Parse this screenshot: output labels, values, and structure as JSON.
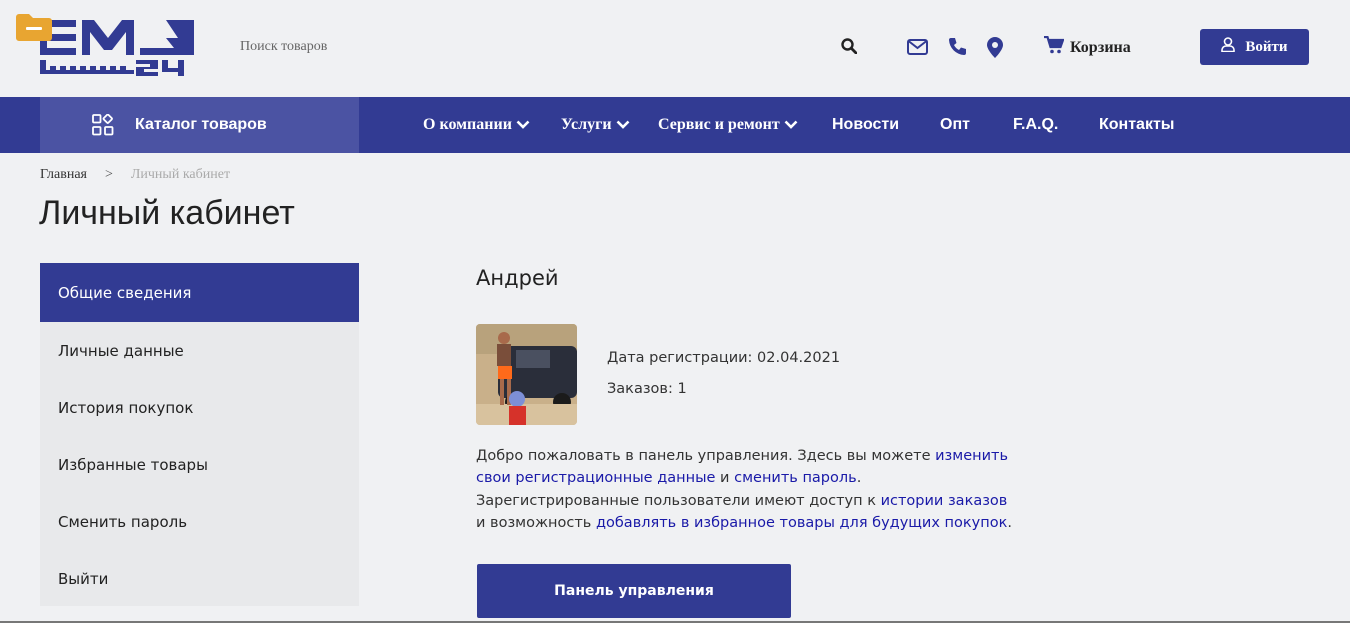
{
  "header": {
    "logo_text": "EM24",
    "search": {
      "placeholder": "Поиск товаров",
      "value": ""
    },
    "cart_label": "Корзина",
    "login_label": "Войти",
    "icons": [
      "search-icon",
      "mail-icon",
      "phone-icon",
      "location-icon",
      "cart-icon",
      "user-icon"
    ]
  },
  "nav": {
    "catalog_label": "Каталог товаров",
    "items": [
      {
        "label": "О компании",
        "has_dropdown": true
      },
      {
        "label": "Услуги",
        "has_dropdown": true
      },
      {
        "label": "Сервис и ремонт",
        "has_dropdown": true
      },
      {
        "label": "Новости",
        "has_dropdown": false
      },
      {
        "label": "Опт",
        "has_dropdown": false
      },
      {
        "label": "F.A.Q.",
        "has_dropdown": false
      },
      {
        "label": "Контакты",
        "has_dropdown": false
      }
    ]
  },
  "breadcrumb": {
    "home": "Главная",
    "separator": ">",
    "current": "Личный кабинет"
  },
  "page_title": "Личный кабинет",
  "sidebar": {
    "items": [
      {
        "label": "Общие сведения",
        "active": true
      },
      {
        "label": "Личные данные",
        "active": false
      },
      {
        "label": "История покупок",
        "active": false
      },
      {
        "label": "Избранные товары",
        "active": false
      },
      {
        "label": "Сменить пароль",
        "active": false
      },
      {
        "label": "Выйти",
        "active": false
      }
    ]
  },
  "profile": {
    "name": "Андрей",
    "registration": "Дата регистрации: 02.04.2021",
    "orders": "Заказов: 1"
  },
  "welcome": {
    "t1": "Добро пожаловать в панель управления. Здесь вы можете ",
    "link1": "изменить свои регистрационные данные",
    "t2": " и ",
    "link2": "сменить пароль",
    "t3": ".",
    "t4": "Зарегистрированные пользователи имеют доступ к ",
    "link3": "истории заказов",
    "t5": " и возможность ",
    "link4": "добавлять в избранное товары для будущих покупок",
    "t6": "."
  },
  "panel_button_label": "Панель управления",
  "colors": {
    "brand": "#323b93",
    "catalog_bg": "#4b53a3",
    "link": "#1a1aa8",
    "badge": "#e8a531"
  }
}
